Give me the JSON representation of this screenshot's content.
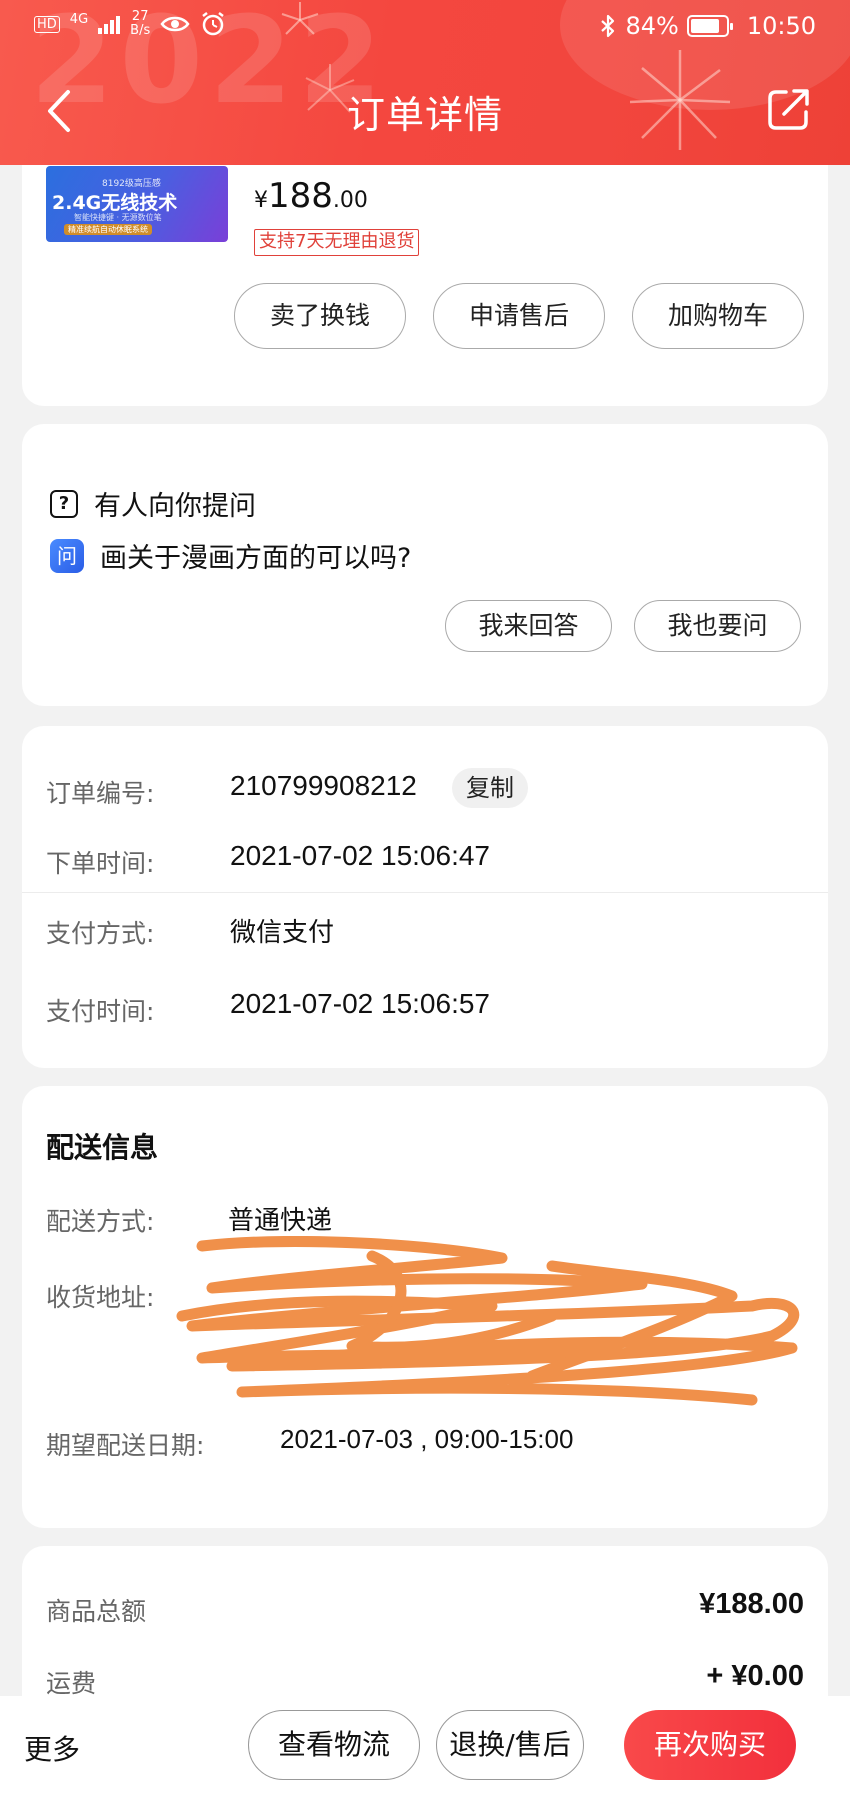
{
  "status_bar": {
    "hd": "HD",
    "network": "4G",
    "speed_top": "27",
    "speed_bottom": "B/s",
    "battery_percent": "84%",
    "battery_level": 0.84,
    "time": "10:50"
  },
  "header": {
    "watermark": "2022",
    "title": "订单详情",
    "bg_color": "#f4473f"
  },
  "product": {
    "image_text": {
      "line1": "8192级高压感",
      "line2": "2.4G无线技术",
      "line3": "智能快捷键 · 无源数位笔",
      "line4": "精准续航自动休眠系统"
    },
    "price_currency": "¥",
    "price_int": "188",
    "price_dec": ".00",
    "return_tag": "支持7天无理由退货",
    "actions": [
      "卖了换钱",
      "申请售后",
      "加购物车"
    ]
  },
  "question": {
    "icon1": "?",
    "header": "有人向你提问",
    "icon2": "问",
    "text": "画关于漫画方面的可以吗?",
    "actions": [
      "我来回答",
      "我也要问"
    ]
  },
  "order_info": {
    "rows": [
      {
        "label": "订单编号:",
        "value": "210799908212"
      },
      {
        "label": "下单时间:",
        "value": "2021-07-02 15:06:47"
      },
      {
        "label": "支付方式:",
        "value": "微信支付"
      },
      {
        "label": "支付时间:",
        "value": "2021-07-02 15:06:57"
      }
    ],
    "copy_label": "复制"
  },
  "delivery": {
    "title": "配送信息",
    "method_label": "配送方式:",
    "method_value": "普通快递",
    "address_label": "收货地址:",
    "date_label": "期望配送日期:",
    "date_value": "2021-07-03 , 09:00-15:00",
    "scribble_color": "#f0904a"
  },
  "amounts": {
    "rows": [
      {
        "label": "商品总额",
        "value": "¥188.00"
      },
      {
        "label": "运费",
        "value": "+ ¥0.00"
      }
    ]
  },
  "bottom_bar": {
    "more": "更多",
    "logistics": "查看物流",
    "return": "退换/售后",
    "rebuy": "再次购买",
    "accent": "#f2303c"
  }
}
